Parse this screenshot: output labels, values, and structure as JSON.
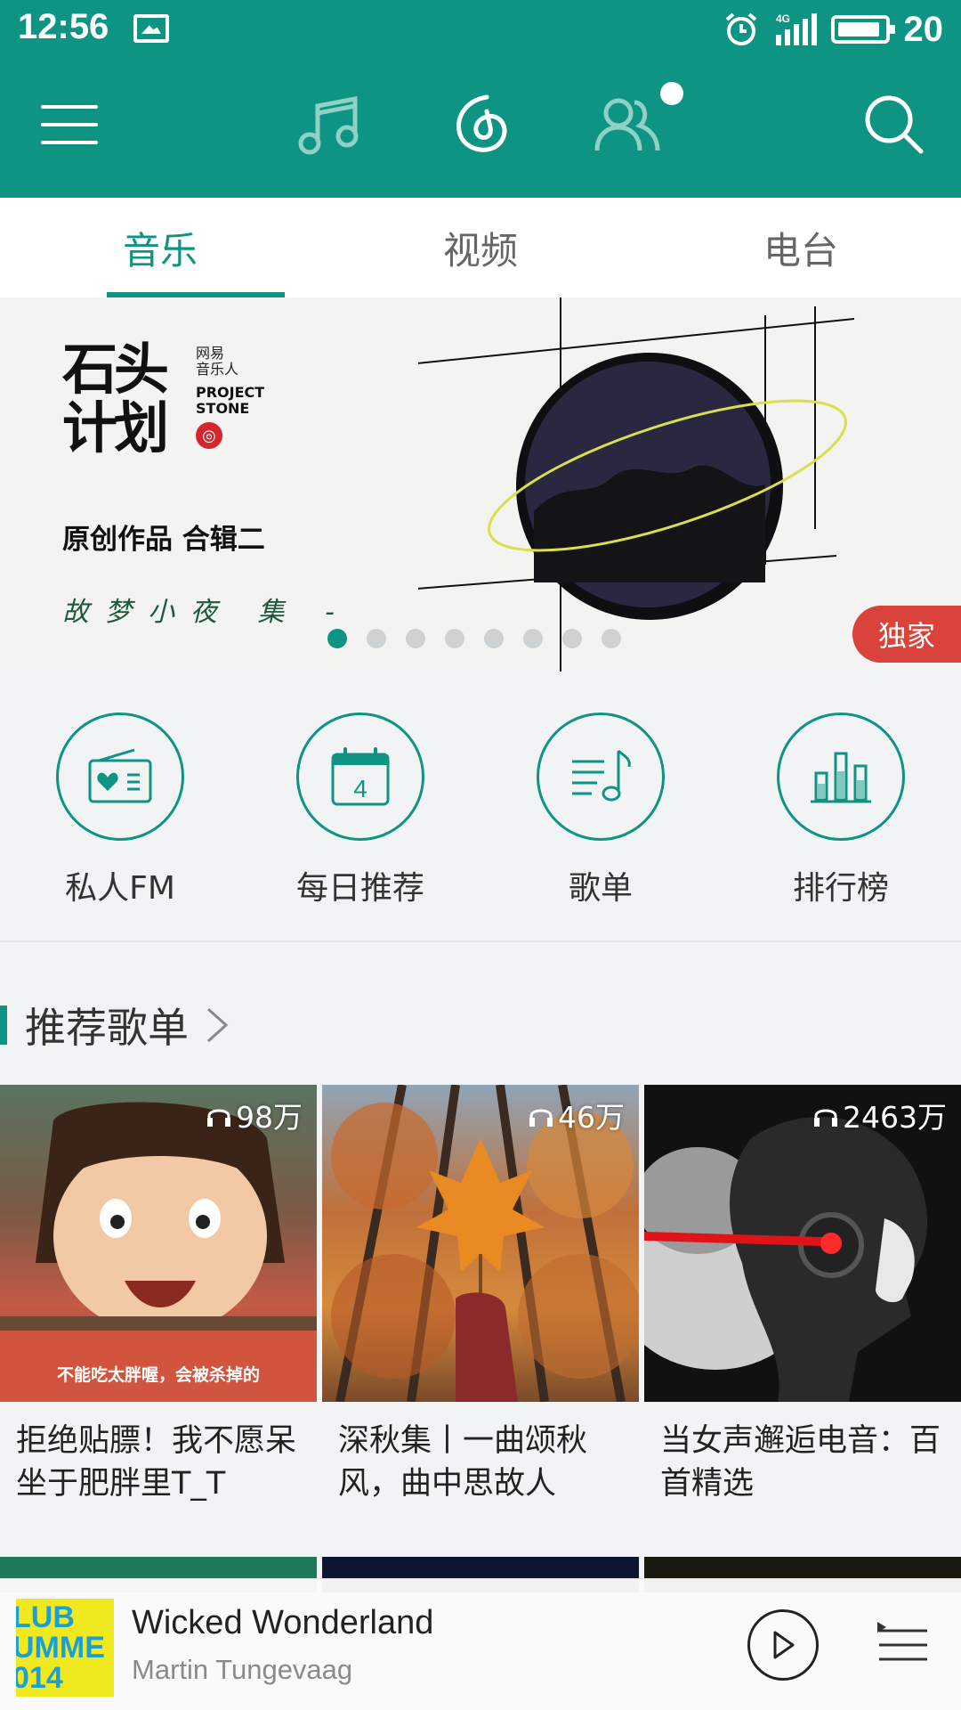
{
  "status": {
    "time": "12:56",
    "network": "4G",
    "battery": "20"
  },
  "tabs": [
    {
      "label": "音乐",
      "active": true
    },
    {
      "label": "视频",
      "active": false
    },
    {
      "label": "电台",
      "active": false
    }
  ],
  "banner": {
    "logo_text": "石头计划",
    "logo_side_cn": "网易音乐人",
    "logo_side_en": "PROJECT STONE",
    "headline": "原创作品 合辑二",
    "sub": "故梦小夜   集 -",
    "tag": "独家",
    "page_total": 8,
    "page_current": 1
  },
  "quick_entries": [
    {
      "label": "私人FM",
      "icon": "radio-icon"
    },
    {
      "label": "每日推荐",
      "icon": "calendar-icon",
      "day": "4"
    },
    {
      "label": "歌单",
      "icon": "playlist-icon"
    },
    {
      "label": "排行榜",
      "icon": "chart-icon"
    }
  ],
  "section": {
    "title": "推荐歌单"
  },
  "playlists": [
    {
      "count": "98万",
      "title": "拒绝贴膘！我不愿呆坐于肥胖里T_T",
      "caption": "不能吃太胖喔，会被杀掉的"
    },
    {
      "count": "46万",
      "title": "深秋集丨一曲颂秋风，曲中思故人"
    },
    {
      "count": "2463万",
      "title": "当女声邂逅电音：百首精选"
    }
  ],
  "player": {
    "title": "Wicked Wonderland",
    "artist": "Martin Tungevaag",
    "art_text": "LUB\nUMME\n014"
  },
  "colors": {
    "accent": "#0e9483",
    "tag": "#d9433c"
  }
}
